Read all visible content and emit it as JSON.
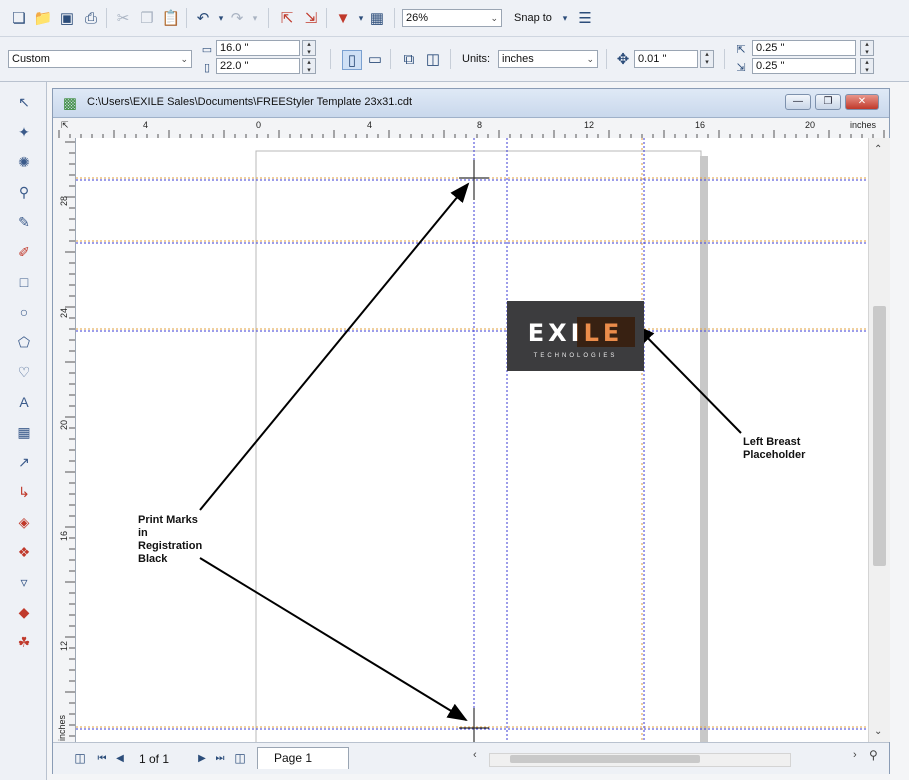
{
  "toolbar": {
    "zoom_value": "26%",
    "snap_label": "Snap to"
  },
  "property_bar": {
    "preset_value": "Custom",
    "width_value": "16.0 \"",
    "height_value": "22.0 \"",
    "units_label": "Units:",
    "units_value": "inches",
    "nudge_value": "0.01 \"",
    "dup_x_value": "0.25 \"",
    "dup_y_value": "0.25 \""
  },
  "document": {
    "title": "C:\\Users\\EXILE Sales\\Documents\\FREEStyler Template 23x31.cdt"
  },
  "ruler_top": {
    "labels": [
      "4",
      "0",
      "4",
      "8",
      "12",
      "16",
      "20"
    ],
    "units": "inches"
  },
  "ruler_left": {
    "labels": [
      "28",
      "24",
      "20",
      "16",
      "12"
    ],
    "units": "inches"
  },
  "canvas": {
    "logo_main": "EXILE",
    "logo_sub": "TECHNOLOGIES",
    "annotation_print_marks": "Print Marks\nin\nRegistration\nBlack",
    "annotation_left_breast": "Left Breast\nPlaceholder"
  },
  "status": {
    "page_count": "1 of 1",
    "page_tab": "Page 1"
  },
  "colors": {
    "accent_orange": "#e8782a",
    "guide_blue": "#3b3bd6",
    "guide_orange": "#e0a040"
  }
}
